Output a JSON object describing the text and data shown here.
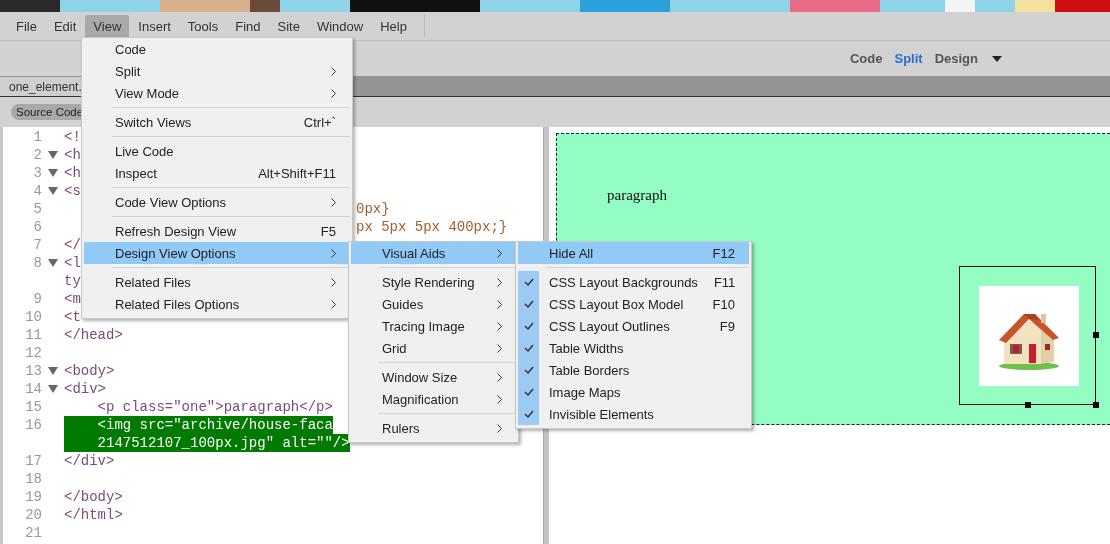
{
  "menubar": {
    "items": [
      {
        "label": "File",
        "selected": false
      },
      {
        "label": "Edit",
        "selected": false
      },
      {
        "label": "View",
        "selected": true
      },
      {
        "label": "Insert",
        "selected": false
      },
      {
        "label": "Tools",
        "selected": false
      },
      {
        "label": "Find",
        "selected": false
      },
      {
        "label": "Site",
        "selected": false
      },
      {
        "label": "Window",
        "selected": false
      },
      {
        "label": "Help",
        "selected": false
      }
    ]
  },
  "view_switch": {
    "items": [
      {
        "label": "Code",
        "selected": false
      },
      {
        "label": "Split",
        "selected": true
      },
      {
        "label": "Design",
        "selected": false
      }
    ]
  },
  "document_tab": {
    "label": "one_element."
  },
  "source_button": {
    "label": "Source Code"
  },
  "code_lines": [
    {
      "number": "1",
      "fold": false,
      "text": "<!"
    },
    {
      "number": "2",
      "fold": true,
      "text": "<h"
    },
    {
      "number": "3",
      "fold": true,
      "text": "<h"
    },
    {
      "number": "4",
      "fold": true,
      "text": "<s"
    },
    {
      "number": "5",
      "fold": false,
      "tail": "0px}"
    },
    {
      "number": "6",
      "fold": false,
      "tail": "px 5px 5px 400px;}"
    },
    {
      "number": "7",
      "fold": false,
      "text": "</"
    },
    {
      "number": "8",
      "fold": true,
      "text": "<l"
    },
    {
      "fold": false,
      "text": "ty"
    },
    {
      "number": "9",
      "fold": false,
      "text": "<m"
    },
    {
      "number": "10",
      "fold": false,
      "text": "<t"
    },
    {
      "number": "11",
      "fold": false,
      "text": "</head>"
    },
    {
      "number": "12",
      "fold": false
    },
    {
      "number": "13",
      "fold": true,
      "text": "<body>"
    },
    {
      "number": "14",
      "fold": true,
      "text": "<div>"
    },
    {
      "number": "15",
      "fold": false,
      "text": "    <p class=\"one\">paragraph</p>"
    },
    {
      "number": "16",
      "fold": false,
      "text": "    <img src=\"archive/house-faca",
      "highlighted": true
    },
    {
      "fold": false,
      "text": "    2147512107_100px.jpg\" alt=\"\"/>",
      "highlighted": true
    },
    {
      "number": "17",
      "fold": false,
      "text": "</div>"
    },
    {
      "number": "18",
      "fold": false
    },
    {
      "number": "19",
      "fold": false,
      "text": "</body>"
    },
    {
      "number": "20",
      "fold": false,
      "text": "</html>"
    },
    {
      "number": "21",
      "fold": false
    }
  ],
  "design_view": {
    "paragraph": "paragraph"
  },
  "menus": [
    {
      "items": [
        {
          "kind": "item",
          "label": "Code",
          "selected": false
        },
        {
          "kind": "item",
          "label": "Split",
          "has_submenu": true,
          "selected": false
        },
        {
          "kind": "item",
          "label": "View Mode",
          "has_submenu": true,
          "selected": false
        },
        {
          "kind": "separator"
        },
        {
          "kind": "item",
          "label": "Switch Views",
          "shortcut": "Ctrl+`",
          "selected": false
        },
        {
          "kind": "separator"
        },
        {
          "kind": "item",
          "label": "Live Code",
          "selected": false
        },
        {
          "kind": "item",
          "label": "Inspect",
          "shortcut": "Alt+Shift+F11",
          "selected": false
        },
        {
          "kind": "separator"
        },
        {
          "kind": "item",
          "label": "Code View Options",
          "has_submenu": true,
          "selected": false
        },
        {
          "kind": "separator"
        },
        {
          "kind": "item",
          "label": "Refresh Design View",
          "shortcut": "F5",
          "selected": false
        },
        {
          "kind": "item",
          "label": "Design View Options",
          "has_submenu": true,
          "selected": true
        },
        {
          "kind": "separator"
        },
        {
          "kind": "item",
          "label": "Related Files",
          "has_submenu": true,
          "selected": false
        },
        {
          "kind": "item",
          "label": "Related Files Options",
          "has_submenu": true,
          "selected": false
        }
      ]
    },
    {
      "items": [
        {
          "kind": "item",
          "label": "Visual Aids",
          "has_submenu": true,
          "selected": true
        },
        {
          "kind": "separator"
        },
        {
          "kind": "item",
          "label": "Style Rendering",
          "has_submenu": true,
          "selected": false
        },
        {
          "kind": "item",
          "label": "Guides",
          "has_submenu": true,
          "selected": false
        },
        {
          "kind": "item",
          "label": "Tracing Image",
          "has_submenu": true,
          "selected": false
        },
        {
          "kind": "item",
          "label": "Grid",
          "has_submenu": true,
          "selected": false
        },
        {
          "kind": "separator"
        },
        {
          "kind": "item",
          "label": "Window Size",
          "has_submenu": true,
          "selected": false
        },
        {
          "kind": "item",
          "label": "Magnification",
          "has_submenu": true,
          "selected": false
        },
        {
          "kind": "separator"
        },
        {
          "kind": "item",
          "label": "Rulers",
          "has_submenu": true,
          "selected": false
        }
      ]
    },
    {
      "items": [
        {
          "kind": "item",
          "label": "Hide All",
          "shortcut": "F12",
          "selected": true,
          "checked": false
        },
        {
          "kind": "separator"
        },
        {
          "kind": "item",
          "label": "CSS Layout Backgrounds",
          "shortcut": "F11",
          "selected": false,
          "checked": true
        },
        {
          "kind": "item",
          "label": "CSS Layout Box Model",
          "shortcut": "F10",
          "selected": false,
          "checked": true
        },
        {
          "kind": "item",
          "label": "CSS Layout Outlines",
          "shortcut": "F9",
          "selected": false,
          "checked": true
        },
        {
          "kind": "item",
          "label": "Table Widths",
          "selected": false,
          "checked": true
        },
        {
          "kind": "item",
          "label": "Table Borders",
          "selected": false,
          "checked": true
        },
        {
          "kind": "item",
          "label": "Image Maps",
          "selected": false,
          "checked": true
        },
        {
          "kind": "item",
          "label": "Invisible Elements",
          "selected": false,
          "checked": true
        }
      ]
    }
  ]
}
